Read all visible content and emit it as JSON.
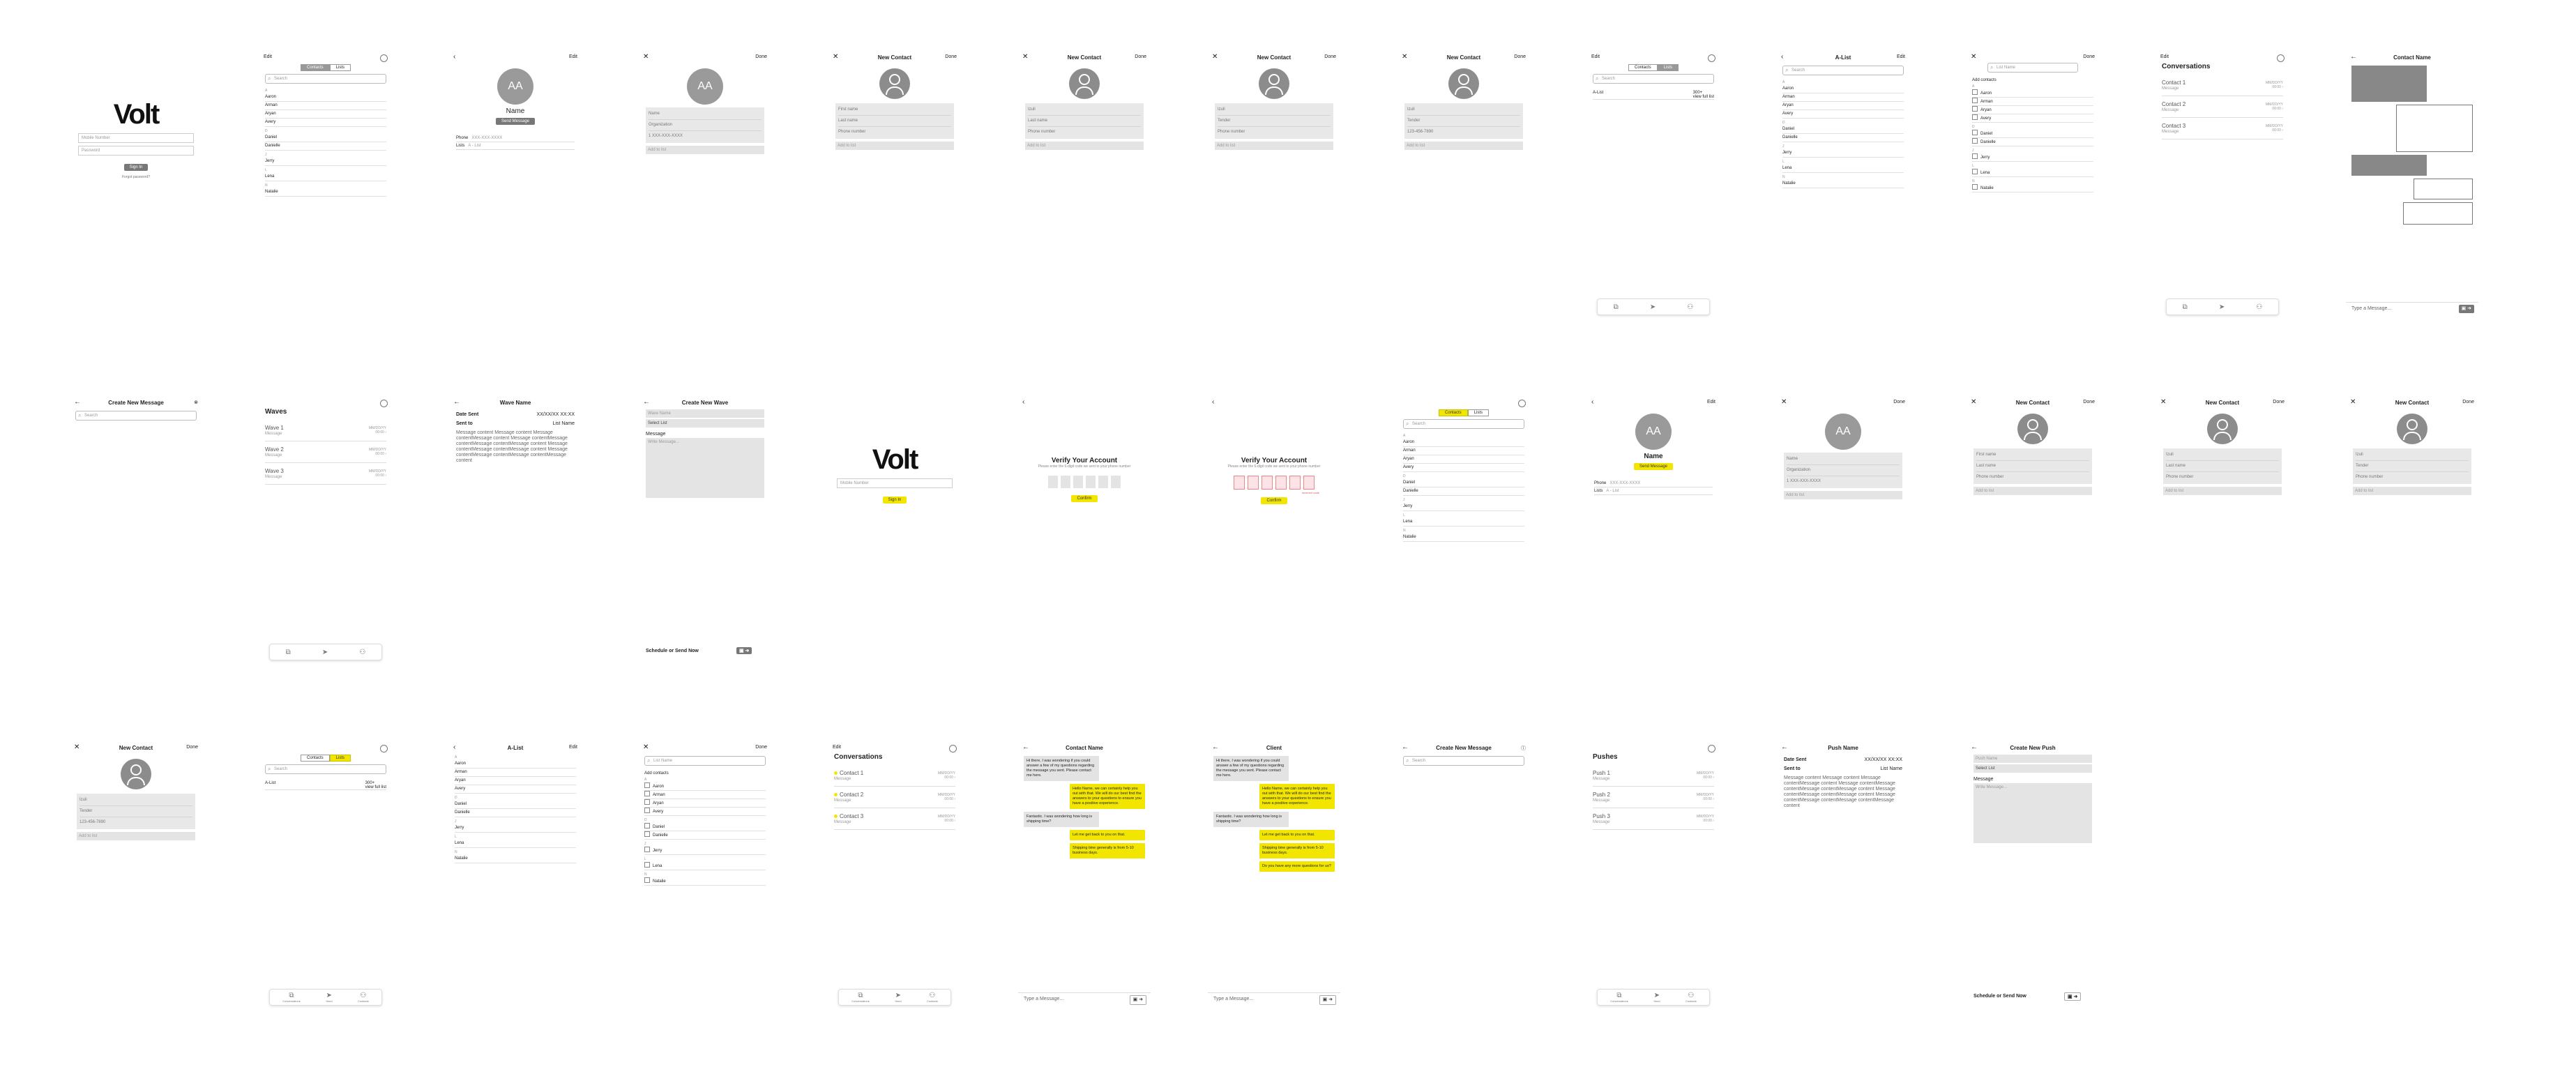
{
  "screens": {
    "login": {
      "logo": "Volt",
      "mobile_placeholder": "Mobile Number",
      "password_placeholder": "Password",
      "signin": "Sign In",
      "forgot": "Forgot password?"
    },
    "contacts": {
      "edit": "Edit",
      "tab_contacts": "Contacts",
      "tab_lists": "Lists",
      "search": "Search"
    },
    "contact_detail": {
      "edit": "Edit",
      "initials": "AA",
      "name": "Name",
      "send": "Send Message",
      "phone_label": "Phone",
      "phone_value": "XXX-XXX-XXXX",
      "lists_label": "Lists",
      "lists_value": "A - List"
    },
    "edit_contact": {
      "done": "Done",
      "initials": "AA",
      "name": "Name",
      "org": "Organization",
      "phone": "Phone number",
      "phone_value": "1 XXX-XXX-XXXX",
      "add_to_list": "Add to list"
    },
    "new_contact": {
      "title": "New Contact",
      "done": "Done",
      "first": "First name",
      "last": "Last name",
      "phone": "Phone number",
      "add_to_list": "Add to list",
      "first_filled": "Izuli",
      "last_filled": "Tender",
      "phone_filled": "123-456-7890"
    },
    "lists": {
      "edit": "Edit",
      "tab_contacts": "Contacts",
      "tab_lists": "Lists",
      "search": "Search",
      "list_name": "A-List",
      "count": "300+",
      "count_sub": "view full list"
    },
    "alist": {
      "title": "A-List",
      "edit": "Edit",
      "search": "Search",
      "add_contacts": "Add contacts",
      "list_name_ph": "List Name"
    },
    "conversations": {
      "edit": "Edit",
      "title": "Conversations",
      "items": [
        {
          "name": "Contact 1",
          "msg": "Message",
          "date": "MM/DD/YY",
          "time": "00:00"
        },
        {
          "name": "Contact 2",
          "msg": "Message",
          "date": "MM/DD/YY",
          "time": "00:00"
        },
        {
          "name": "Contact 3",
          "msg": "Message",
          "date": "MM/DD/YY",
          "time": "00:00"
        }
      ]
    },
    "chat": {
      "title": "Contact Name",
      "compose": "Type a Message...",
      "client": "Client"
    },
    "create_message": {
      "title": "Create New Message",
      "search": "Search"
    },
    "waves": {
      "title": "Waves",
      "items": [
        {
          "name": "Wave 1",
          "msg": "Message",
          "date": "MM/DD/YY",
          "time": "00:00"
        },
        {
          "name": "Wave 2",
          "msg": "Message",
          "date": "MM/DD/YY",
          "time": "00:00"
        },
        {
          "name": "Wave 3",
          "msg": "Message",
          "date": "MM/DD/YY",
          "time": "00:00"
        }
      ]
    },
    "wave_detail": {
      "title": "Wave Name",
      "date_label": "Date Sent",
      "date_value": "XX/XX/XX XX:XX",
      "sent_label": "Sent to",
      "sent_value": "List Name",
      "body": "Message content Message content Message contentMessage content Message contentMessage contentMessage contentMessage content Message contentMessage contentMessage content Message contentMessage contentMessage contentMessage content"
    },
    "create_wave": {
      "title": "Create New Wave",
      "wave_name": "Wave Name",
      "select_list": "Select List",
      "message_label": "Message",
      "message_ph": "Write Message...",
      "schedule": "Schedule or Send Now"
    },
    "login_y": {
      "logo": "Volt",
      "mobile_placeholder": "Mobile Number",
      "signin": "Sign In"
    },
    "verify": {
      "title": "Verify Your Account",
      "sub": "Please enter the 6-digit code we sent to your phone number",
      "confirm": "Confirm",
      "error": "Incorrect code"
    },
    "pushes": {
      "title": "Pushes",
      "items": [
        {
          "name": "Push 1",
          "msg": "Message",
          "date": "MM/DD/YY",
          "time": "00:00"
        },
        {
          "name": "Push 2",
          "msg": "Message",
          "date": "MM/DD/YY",
          "time": "00:00"
        },
        {
          "name": "Push 3",
          "msg": "Message",
          "date": "MM/DD/YY",
          "time": "00:00"
        }
      ]
    },
    "push_detail": {
      "title": "Push Name",
      "date_label": "Date Sent",
      "date_value": "XX/XX/XX XX:XX",
      "sent_label": "Sent to",
      "sent_value": "List Name"
    },
    "create_push": {
      "title": "Create New Push",
      "push_name": "Push Name",
      "select_list": "Select List",
      "message_label": "Message",
      "message_ph": "Write Message...",
      "schedule": "Schedule or Send Now"
    }
  },
  "names": [
    "Aaron",
    "Arman",
    "Aryan",
    "Avery",
    "Daniel",
    "Danielle",
    "Jerry",
    "Lena",
    "Natalie"
  ],
  "letters": [
    "A",
    "D",
    "J",
    "L",
    "N"
  ],
  "tabbar": [
    "Conversations",
    "Send",
    "Contacts"
  ],
  "chat_messages": [
    "Hi there, I was wondering if you could answer a few of my questions regarding the message you sent. Please contact me here.",
    "Hello Name, we can certainly help you out with that. We will do our best find the answers to your questions to ensure you have a positive experience.",
    "Fantastic. I was wondering how long is shipping time?",
    "Let me get back to you on that.",
    "Shipping time generally is from 5-10 business days.",
    "Do you have any more questions for us?"
  ],
  "colors": {
    "accent": "#f2e600",
    "grey": "#8c8c8c"
  }
}
